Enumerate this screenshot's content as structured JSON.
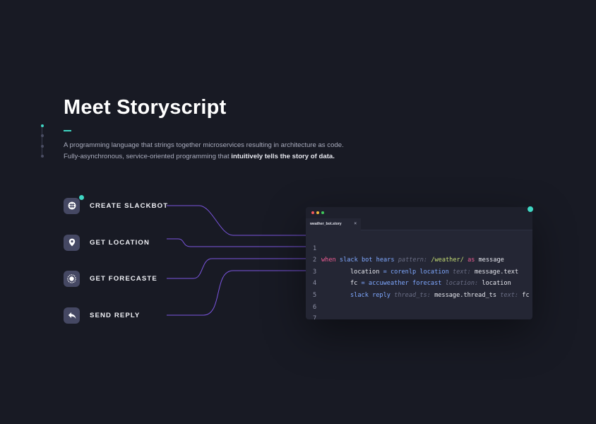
{
  "heading": {
    "title": "Meet Storyscript",
    "desc_line1": "A programming language that strings together microservices resulting in architecture as code.",
    "desc_line2_plain": "Fully-asynchronous, service-oriented programming that ",
    "desc_line2_bold": "intuitively tells the story of data."
  },
  "steps": [
    {
      "label": "CREATE SLACKBOT",
      "icon": "slack-icon"
    },
    {
      "label": "GET LOCATION",
      "icon": "location-pin-icon"
    },
    {
      "label": "GET FORECASTE",
      "icon": "sun-icon"
    },
    {
      "label": "SEND REPLY",
      "icon": "reply-icon"
    }
  ],
  "editor": {
    "tab_name": "weather_bot.story",
    "tab_close": "×",
    "line_numbers": [
      "1",
      "2",
      "3",
      "4",
      "5",
      "6",
      "7"
    ],
    "line1": {
      "kw": "when",
      "svc": "slack",
      "cmd": "bot hears",
      "arg": "pattern:",
      "val": "/weather/",
      "as": "as",
      "var": "message"
    },
    "line2": {
      "var": "location",
      "eq": "=",
      "svc": "corenlp",
      "cmd": "location",
      "arg": "text:",
      "val": "message.text"
    },
    "line3": {
      "var": "fc",
      "eq": "=",
      "svc": "accuweather",
      "cmd": "forecast",
      "arg": "location:",
      "val": "location"
    },
    "line4": {
      "svc": "slack",
      "cmd": "reply",
      "arg1": "thread_ts:",
      "val1": "message.thread_ts",
      "arg2": "text:",
      "val2": "fc"
    }
  },
  "colors": {
    "background": "#181a24",
    "accent": "#3fd6c3",
    "connector": "#7b55e0",
    "keyword": "#f05d94",
    "service": "#7fa8ff",
    "regex": "#c4dc73"
  }
}
